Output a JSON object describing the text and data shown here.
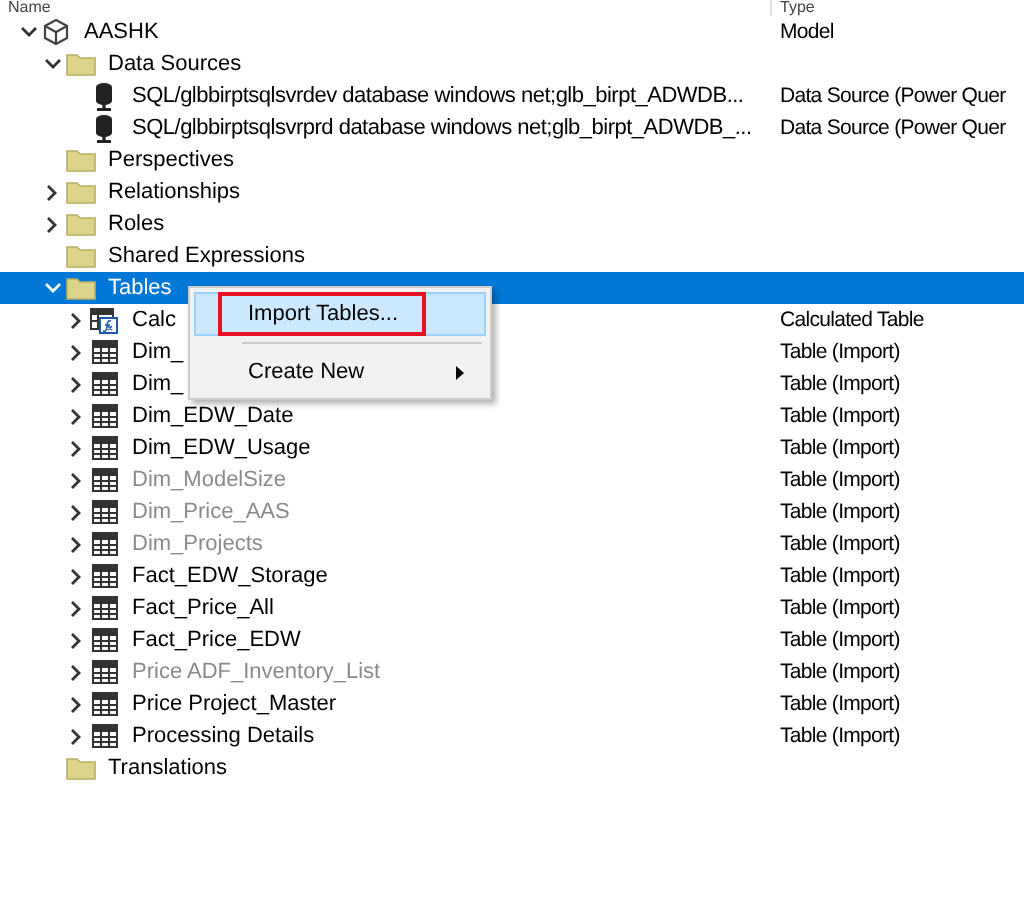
{
  "header": {
    "columns": [
      "Name",
      "Type"
    ]
  },
  "tree": [
    {
      "label": "AASHK",
      "type": "Model",
      "kind": "model",
      "expanded": true,
      "selected": false,
      "children": [
        {
          "label": "Data Sources",
          "kind": "folder",
          "expanded": true,
          "selected": false,
          "children": [
            {
              "label": "SQL/glbbirptsqlsvrdev database windows net;glb_birpt_ADWDB...",
              "type": "Data Source (Power Quer",
              "kind": "datasource",
              "selected": false
            },
            {
              "label": "SQL/glbbirptsqlsvrprd database windows net;glb_birpt_ADWDB_...",
              "type": "Data Source (Power Quer",
              "kind": "datasource",
              "selected": false
            }
          ]
        },
        {
          "label": "Perspectives",
          "kind": "folder",
          "selected": false
        },
        {
          "label": "Relationships",
          "kind": "folder",
          "expanded": false,
          "selected": false
        },
        {
          "label": "Roles",
          "kind": "folder",
          "expanded": false,
          "selected": false
        },
        {
          "label": "Shared Expressions",
          "kind": "folder",
          "selected": false
        },
        {
          "label": "Tables",
          "kind": "folder",
          "expanded": true,
          "selected": true,
          "children": [
            {
              "label": "Calc",
              "type": "Calculated Table",
              "kind": "calculated_table",
              "expanded": false,
              "hidden": false,
              "selected": false
            },
            {
              "label": "Dim_",
              "type": "Table (Import)",
              "kind": "table",
              "expanded": false,
              "hidden": false,
              "selected": false
            },
            {
              "label": "Dim_",
              "type": "Table (Import)",
              "kind": "table",
              "expanded": false,
              "hidden": false,
              "selected": false
            },
            {
              "label": "Dim_EDW_Date",
              "type": "Table (Import)",
              "kind": "table",
              "expanded": false,
              "hidden": false,
              "selected": false
            },
            {
              "label": "Dim_EDW_Usage",
              "type": "Table (Import)",
              "kind": "table",
              "expanded": false,
              "hidden": false,
              "selected": false
            },
            {
              "label": "Dim_ModelSize",
              "type": "Table (Import)",
              "kind": "table",
              "expanded": false,
              "hidden": true,
              "selected": false
            },
            {
              "label": "Dim_Price_AAS",
              "type": "Table (Import)",
              "kind": "table",
              "expanded": false,
              "hidden": true,
              "selected": false
            },
            {
              "label": "Dim_Projects",
              "type": "Table (Import)",
              "kind": "table",
              "expanded": false,
              "hidden": true,
              "selected": false
            },
            {
              "label": "Fact_EDW_Storage",
              "type": "Table (Import)",
              "kind": "table",
              "expanded": false,
              "hidden": false,
              "selected": false
            },
            {
              "label": "Fact_Price_All",
              "type": "Table (Import)",
              "kind": "table",
              "expanded": false,
              "hidden": false,
              "selected": false
            },
            {
              "label": "Fact_Price_EDW",
              "type": "Table (Import)",
              "kind": "table",
              "expanded": false,
              "hidden": false,
              "selected": false
            },
            {
              "label": "Price ADF_Inventory_List",
              "type": "Table (Import)",
              "kind": "table",
              "expanded": false,
              "hidden": true,
              "selected": false
            },
            {
              "label": "Price Project_Master",
              "type": "Table (Import)",
              "kind": "table",
              "expanded": false,
              "hidden": false,
              "selected": false
            },
            {
              "label": "Processing Details",
              "type": "Table (Import)",
              "kind": "table",
              "expanded": false,
              "hidden": false,
              "selected": false
            }
          ]
        },
        {
          "label": "Translations",
          "kind": "folder",
          "selected": false
        }
      ]
    }
  ],
  "context_menu": {
    "items": [
      {
        "label": "Import Tables...",
        "kind": "command",
        "selected": true,
        "annotated": true
      },
      {
        "kind": "separator"
      },
      {
        "label": "Create New",
        "kind": "submenu",
        "selected": false,
        "annotated": false
      }
    ]
  }
}
